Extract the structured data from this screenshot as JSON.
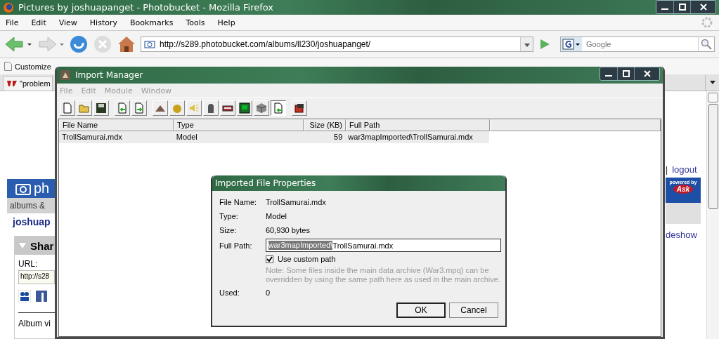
{
  "browser": {
    "title": "Pictures by joshuapanget - Photobucket - Mozilla Firefox",
    "menu": [
      "File",
      "Edit",
      "View",
      "History",
      "Bookmarks",
      "Tools",
      "Help"
    ],
    "address": "http://s289.photobucket.com/albums/ll230/joshuapanget/",
    "search_placeholder": "Google",
    "bookmarks": [
      "Customize"
    ],
    "tabs": [
      {
        "label": "\"problem",
        "selected": true
      }
    ],
    "page": {
      "left": {
        "logo": "ph",
        "nav": "albums &",
        "username": "joshuap",
        "panel_title": "Shar",
        "url_label": "URL:",
        "url_value": "http://s28",
        "footer": "Album vi"
      },
      "right": {
        "separator": "|",
        "logout": "logout",
        "powered_by": "powered by",
        "ask": "Ask",
        "slideshow": "deshow"
      }
    }
  },
  "import_manager": {
    "title": "Import Manager",
    "menu": [
      {
        "label": "File",
        "disabled": true
      },
      {
        "label": "Edit",
        "disabled": true
      },
      {
        "label": "Module",
        "disabled": true
      },
      {
        "label": "Window",
        "disabled": true
      }
    ],
    "toolbar": [
      [
        {
          "pressed": false
        },
        {
          "pressed": false
        },
        {
          "pressed": false
        }
      ],
      [
        {
          "pressed": false
        },
        {
          "pressed": false
        }
      ],
      [
        {
          "pressed": false
        },
        {
          "pressed": false
        },
        {
          "pressed": false
        },
        {
          "pressed": false
        },
        {
          "pressed": false
        },
        {
          "pressed": false
        },
        {
          "pressed": false
        },
        {
          "pressed": true
        }
      ],
      [
        {
          "pressed": false
        }
      ]
    ],
    "columns": [
      "File Name",
      "Type",
      "Size (KB)",
      "Full Path"
    ],
    "rows": [
      {
        "cells": [
          "TrollSamurai.mdx",
          "Model",
          "59",
          "war3mapImported\\TrollSamurai.mdx"
        ],
        "selected": true
      }
    ]
  },
  "dialog": {
    "title": "Imported File Properties",
    "fields": [
      {
        "label": "File Name:",
        "value": "TrollSamurai.mdx"
      },
      {
        "label": "Type:",
        "value": "Model"
      },
      {
        "label": "Size:",
        "value": "60,930 bytes"
      }
    ],
    "full_path": {
      "label": "Full Path:",
      "selected_part": "war3mapImported\\",
      "rest": "TrollSamurai.mdx"
    },
    "custom_path": {
      "label": "Use custom path",
      "checked": true
    },
    "note": "Note: Some files inside the main data archive (War3.mpq) can be overridden by using the same path here as used in the main archive.",
    "used": {
      "label": "Used:",
      "value": "0"
    },
    "buttons": [
      {
        "label": "OK",
        "default": true
      },
      {
        "label": "Cancel",
        "default": false
      }
    ]
  }
}
